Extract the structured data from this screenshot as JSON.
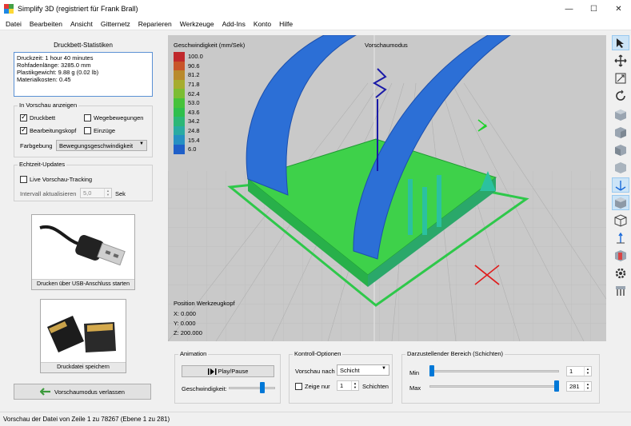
{
  "window": {
    "title": "Simplify 3D (registriert für Frank Brall)",
    "minimize": "—",
    "maximize": "☐",
    "close": "✕"
  },
  "menu": [
    "Datei",
    "Bearbeiten",
    "Ansicht",
    "Gitternetz",
    "Reparieren",
    "Werkzeuge",
    "Add-Ins",
    "Konto",
    "Hilfe"
  ],
  "stats": {
    "title": "Druckbett-Statistiken",
    "lines": [
      "Druckzeit: 1 hour 40 minutes",
      "Rohfadenlänge: 3285.0 mm",
      "Plastikgewicht: 9.88 g (0.02 lb)",
      "Materialkosten: 0.45"
    ]
  },
  "preview_options": {
    "title": "In Vorschau anzeigen",
    "print_bed": "Druckbett",
    "travel_moves": "Wegebewegungen",
    "tool_head": "Bearbeitungskopf",
    "retractions": "Einzüge",
    "print_bed_checked": true,
    "travel_moves_checked": false,
    "tool_head_checked": true,
    "retractions_checked": false,
    "coloring_label": "Farbgebung",
    "coloring_value": "Bewegungsgeschwindigkeit"
  },
  "realtime": {
    "title": "Echtzeit-Updates",
    "live_tracking": "Live Vorschau-Tracking",
    "live_tracking_checked": false,
    "interval_label": "Intervall aktualisieren",
    "interval_value": "5,0",
    "interval_unit": "Sek"
  },
  "usb_card": {
    "caption": "Drucken über USB-Anschluss starten"
  },
  "sd_card": {
    "caption": "Druckdatei speichern"
  },
  "exit_button": "Vorschaumodus verlassen",
  "viewport": {
    "legend_title": "Geschwindigkeit (mm/Sek)",
    "legend": [
      {
        "value": "100.0",
        "color": "#c0282c"
      },
      {
        "value": "90.6",
        "color": "#c8552a"
      },
      {
        "value": "81.2",
        "color": "#b98a2d"
      },
      {
        "value": "71.8",
        "color": "#a6ad2f"
      },
      {
        "value": "62.4",
        "color": "#7cbd33"
      },
      {
        "value": "53.0",
        "color": "#46c23a"
      },
      {
        "value": "43.6",
        "color": "#2fbf4c"
      },
      {
        "value": "34.2",
        "color": "#2cb777"
      },
      {
        "value": "24.8",
        "color": "#2aaba2"
      },
      {
        "value": "15.4",
        "color": "#2690c2"
      },
      {
        "value": "6.0",
        "color": "#1f5fc8"
      }
    ],
    "mode_label": "Vorschaumodus",
    "tool_position_title": "Position Werkzeugkopf",
    "x": "X: 0.000",
    "y": "Y: 0.000",
    "z": "Z: 200.000"
  },
  "animation": {
    "title": "Animation",
    "play_pause": "Play/Pause",
    "speed_label": "Geschwindigkeit:",
    "speed_fraction": 0.75
  },
  "control": {
    "title": "Kontroll-Optionen",
    "preview_by_label": "Vorschau nach",
    "preview_by_value": "Schicht",
    "only_show_label": "Zeige nur",
    "only_show_checked": false,
    "only_show_value": "1",
    "layers_label": "Schichten"
  },
  "range": {
    "title": "Darzustellender Bereich (Schichten)",
    "min_label": "Min",
    "max_label": "Max",
    "min_value": "1",
    "max_value": "281",
    "min_fraction": 0.0,
    "max_fraction": 1.0
  },
  "status": "Vorschau der Datei von Zeile 1 zu 78267 (Ebene 1 zu 281)"
}
